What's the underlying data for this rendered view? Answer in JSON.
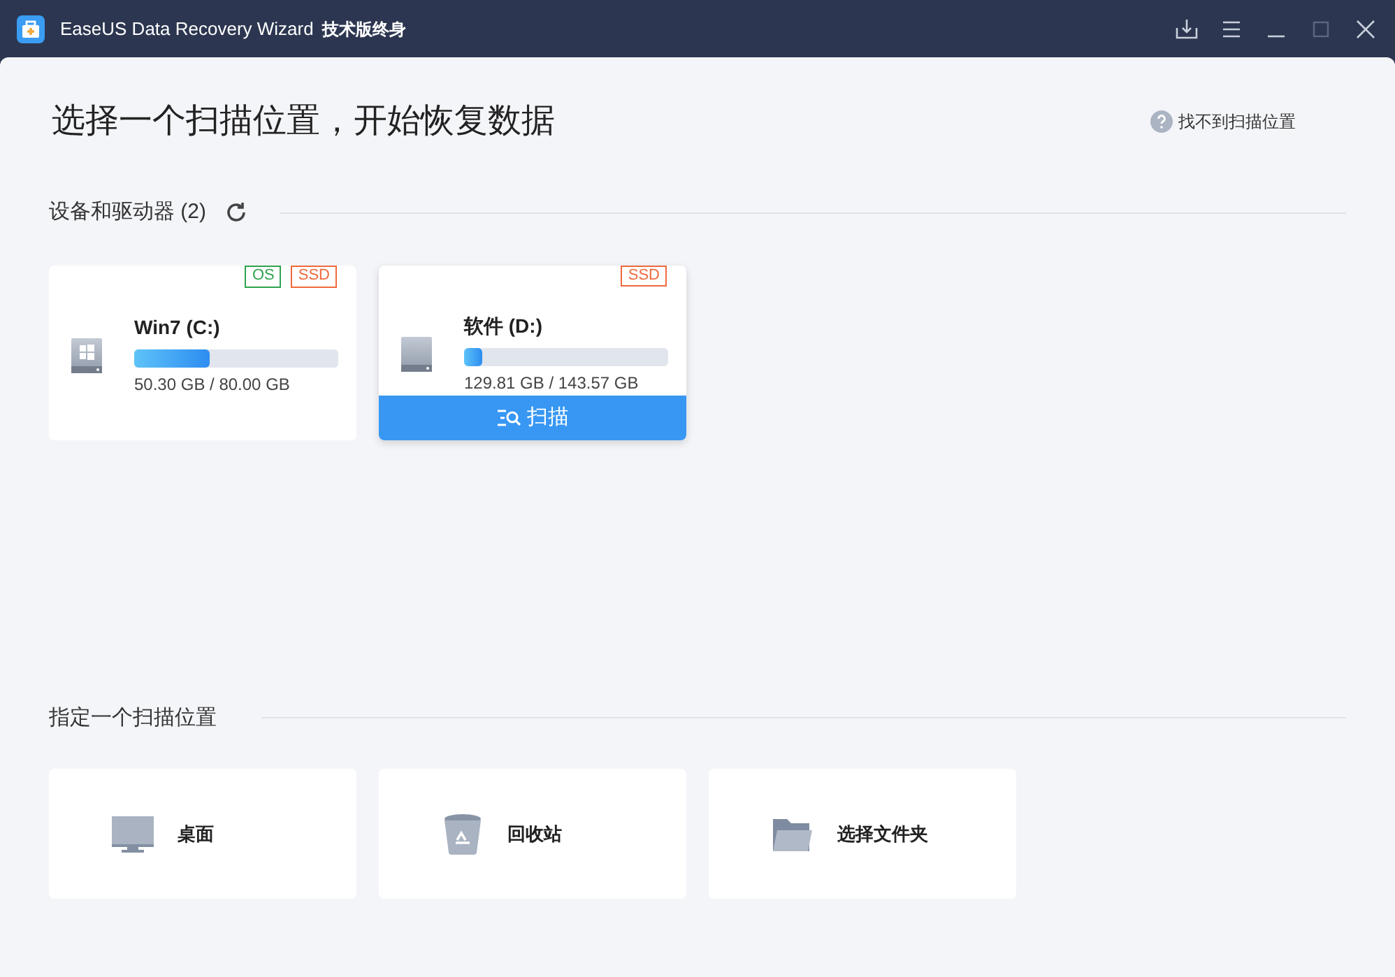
{
  "window": {
    "title": "EaseUS Data Recovery Wizard",
    "edition": "技术版终身"
  },
  "heading": "选择一个扫描位置，开始恢复数据",
  "help_link": "找不到扫描位置",
  "devices": {
    "title": "设备和驱动器 (2)",
    "drives": [
      {
        "name": "Win7 (C:)",
        "kind": "windows",
        "tags": [
          {
            "label": "OS",
            "color": "#2ea44f"
          },
          {
            "label": "SSD",
            "color": "#f06a3c"
          }
        ],
        "level": 0.37,
        "usage": "50.30 GB / 80.00 GB",
        "selected": false
      },
      {
        "name": "软件 (D:)",
        "kind": "plain",
        "tags": [
          {
            "label": "SSD",
            "color": "#f06a3c"
          }
        ],
        "level": 0.09,
        "usage": "129.81 GB / 143.57 GB",
        "selected": true,
        "scan_label": "扫描"
      }
    ]
  },
  "locations": {
    "title": "指定一个扫描位置",
    "items": [
      {
        "kind": "desktop",
        "label": "桌面"
      },
      {
        "kind": "recycle",
        "label": "回收站"
      },
      {
        "kind": "folder",
        "label": "选择文件夹"
      }
    ]
  }
}
